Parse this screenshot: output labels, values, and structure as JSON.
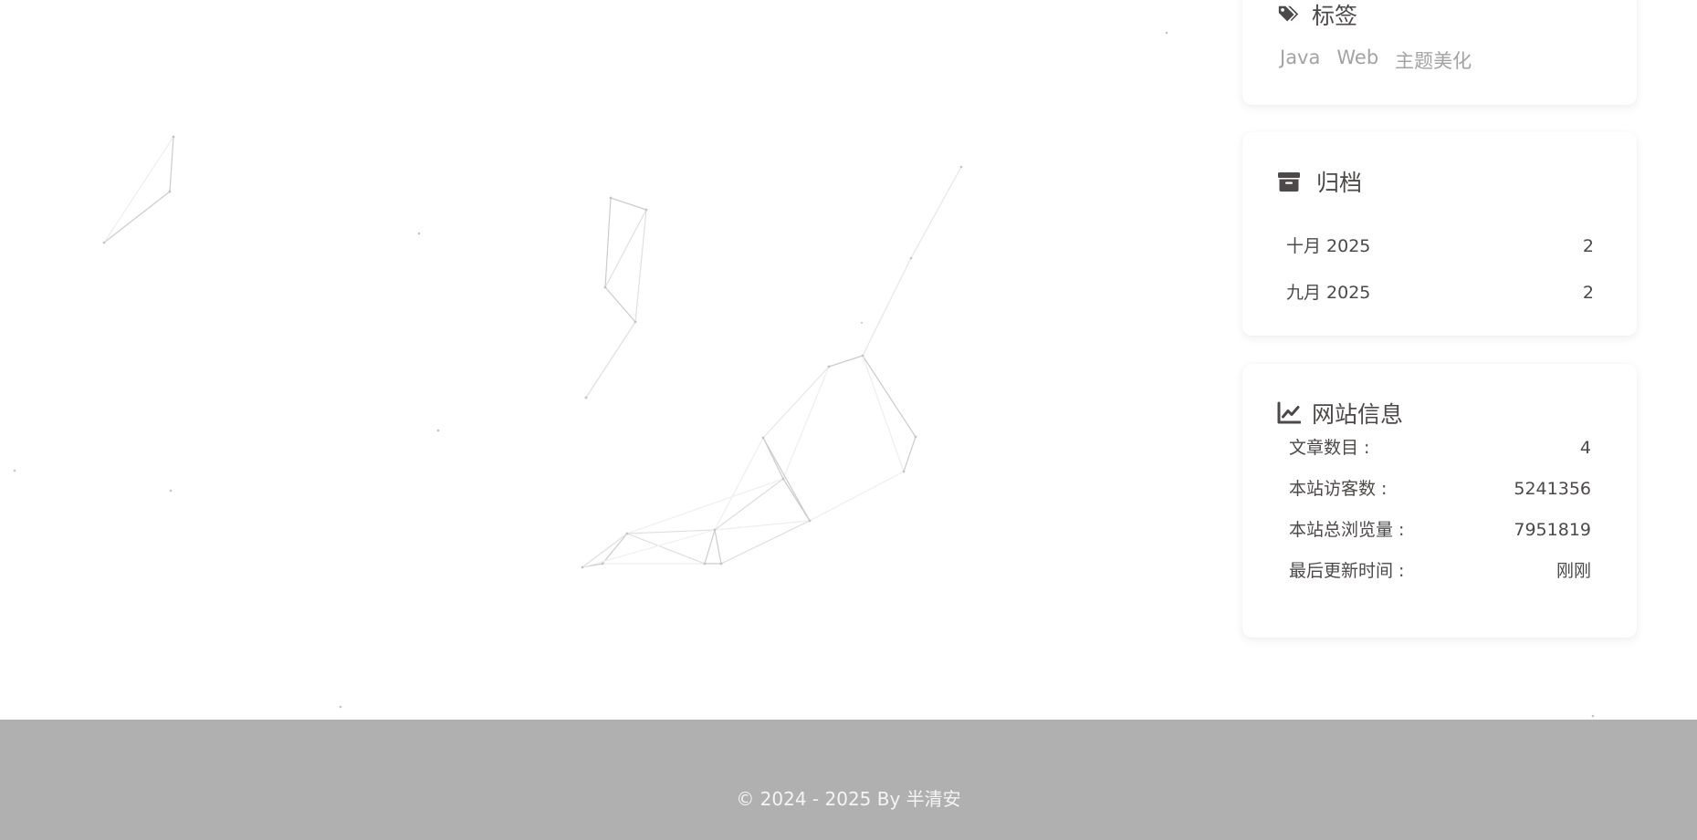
{
  "tags_card": {
    "title": "标签",
    "icon": "tags-icon",
    "tags": [
      "Java",
      "Web",
      "主题美化"
    ]
  },
  "archive_card": {
    "title": "归档",
    "icon": "archive-icon",
    "items": [
      {
        "label": "十月 2025",
        "count": "2"
      },
      {
        "label": "九月 2025",
        "count": "2"
      }
    ]
  },
  "info_card": {
    "title": "网站信息",
    "icon": "chart-line-icon",
    "items": [
      {
        "label": "文章数目 :",
        "value": "4"
      },
      {
        "label": "本站访客数 :",
        "value": "5241356"
      },
      {
        "label": "本站总浏览量 :",
        "value": "7951819"
      },
      {
        "label": "最后更新时间 :",
        "value": "刚刚"
      }
    ]
  },
  "footer": {
    "copyright": "© 2024 - 2025 By 半清安"
  },
  "colors": {
    "footer_bg": "#b0b0b0",
    "tag_text": "#a3a3a3",
    "body_text": "#4c4948"
  }
}
